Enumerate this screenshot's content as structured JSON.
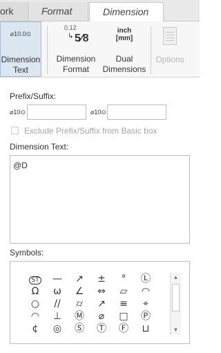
{
  "tabs": [
    {
      "label": "ork"
    },
    {
      "label": "Format"
    },
    {
      "label": "Dimension"
    }
  ],
  "ribbon": {
    "dimension_text": {
      "icon_text": "⌀10.0⊙",
      "label_line1": "Dimension",
      "label_line2": "Text"
    },
    "dimension_format": {
      "icon_top": "0.12",
      "icon_frac": "5⁄8",
      "label_line1": "Dimension",
      "label_line2": "Format"
    },
    "dual_dimensions": {
      "icon_line1": "inch",
      "icon_line2": "[mm]",
      "label_line1": "Dual",
      "label_line2": "Dimensions"
    },
    "options": {
      "label": "Options"
    }
  },
  "prefix_suffix": {
    "label": "Prefix/Suffix:",
    "prefix_symbol": "⌀10⊙",
    "suffix_symbol": "⌀10⊙",
    "prefix_value": "",
    "suffix_value": ""
  },
  "exclude_checkbox": {
    "label": "Exclude Prefix/Suffix from Basic box",
    "checked": false
  },
  "dimension_text": {
    "label": "Dimension Text:",
    "value": "@D"
  },
  "symbols": {
    "label": "Symbols:",
    "rows": [
      [
        "ST",
        "—",
        "↗",
        "±",
        "°",
        "Ⓛ"
      ],
      [
        "Ω",
        "ω",
        "∠",
        "⇔",
        "▱",
        "◠"
      ],
      [
        "○",
        "//",
        "⌭",
        "↗",
        "≡",
        "⌖"
      ],
      [
        "◠",
        "⊥",
        "Ⓜ",
        "⌀",
        "□",
        "Ⓟ"
      ],
      [
        "¢",
        "◎",
        "Ⓢ",
        "Ⓣ",
        "Ⓕ",
        "⊔"
      ]
    ]
  }
}
